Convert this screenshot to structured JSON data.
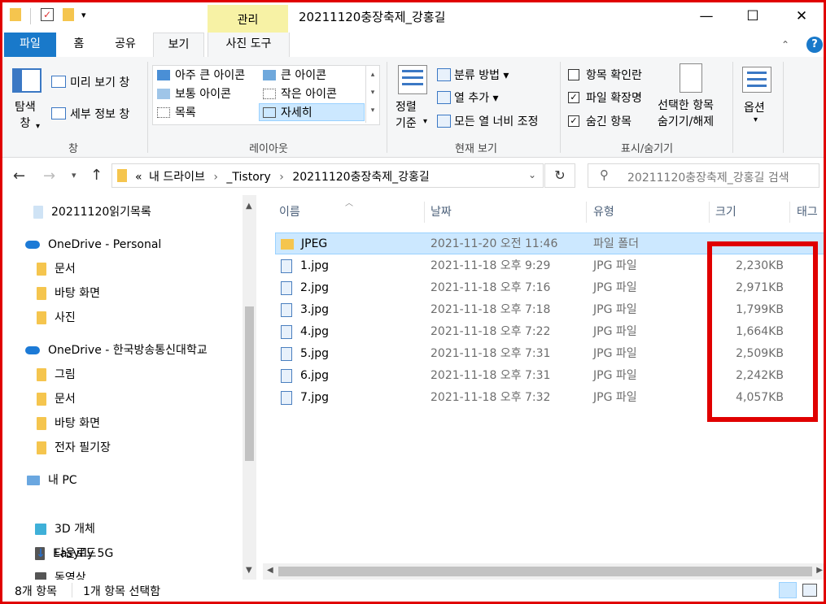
{
  "window": {
    "title": "20211120충장축제_강홍길",
    "context_tab": "관리",
    "controls": {
      "minimize": "—",
      "maximize": "☐",
      "close": "✕"
    }
  },
  "ribbon_tabs": [
    {
      "label": "파일"
    },
    {
      "label": "홈"
    },
    {
      "label": "공유"
    },
    {
      "label": "보기"
    },
    {
      "label": "사진 도구"
    }
  ],
  "ribbon": {
    "pane": {
      "nav_pane": "탐색\n창",
      "preview": "미리 보기 창",
      "details": "세부 정보 창",
      "group": "창"
    },
    "layout": {
      "items": [
        "아주 큰 아이콘",
        "큰 아이콘",
        "보통 아이콘",
        "작은 아이콘",
        "목록",
        "자세히"
      ],
      "group": "레이아웃"
    },
    "current_view": {
      "sort_by": "정렬\n기준",
      "group_by": "분류 방법",
      "add_columns": "열 추가",
      "fit_columns": "모든 열 너비 조정",
      "group": "현재 보기"
    },
    "show_hide": {
      "checkboxes": "항목 확인란",
      "extensions": "파일 확장명",
      "hidden": "숨긴 항목",
      "hide_selected": "선택한 항목\n숨기기/해제",
      "group": "표시/숨기기"
    },
    "options": {
      "label": "옵션"
    }
  },
  "address": {
    "crumbs": [
      "«",
      "내 드라이브",
      "_Tistory",
      "20211120충장축제_강홍길"
    ],
    "search_placeholder": "20211120충장축제_강홍길 검색"
  },
  "nav": {
    "items": [
      {
        "label": "20211120읽기목록",
        "icon": "cloud-folder"
      },
      {
        "label": "OneDrive - Personal",
        "icon": "onedrive"
      },
      {
        "label": "문서",
        "icon": "folder"
      },
      {
        "label": "바탕 화면",
        "icon": "folder"
      },
      {
        "label": "사진",
        "icon": "folder"
      },
      {
        "label": "OneDrive - 한국방송통신대학교",
        "icon": "onedrive"
      },
      {
        "label": "그림",
        "icon": "folder"
      },
      {
        "label": "문서",
        "icon": "folder"
      },
      {
        "label": "바탕 화면",
        "icon": "folder"
      },
      {
        "label": "전자 필기장",
        "icon": "folder"
      },
      {
        "label": "내 PC",
        "icon": "pc"
      },
      {
        "label": "3D 개체",
        "icon": "3d"
      },
      {
        "label": "Easyfly 5G",
        "icon": "device"
      },
      {
        "label": "다운로드",
        "icon": "download"
      },
      {
        "label": "동영상",
        "icon": "video"
      }
    ]
  },
  "columns": {
    "name": "이름",
    "date": "날짜",
    "type": "유형",
    "size": "크기",
    "tags": "태그"
  },
  "files": [
    {
      "name": "JPEG",
      "date": "2021-11-20 오전 11:46",
      "type": "파일 폴더",
      "size": ""
    },
    {
      "name": "1.jpg",
      "date": "2021-11-18 오후 9:29",
      "type": "JPG 파일",
      "size": "2,230KB"
    },
    {
      "name": "2.jpg",
      "date": "2021-11-18 오후 7:16",
      "type": "JPG 파일",
      "size": "2,971KB"
    },
    {
      "name": "3.jpg",
      "date": "2021-11-18 오후 7:18",
      "type": "JPG 파일",
      "size": "1,799KB"
    },
    {
      "name": "4.jpg",
      "date": "2021-11-18 오후 7:22",
      "type": "JPG 파일",
      "size": "1,664KB"
    },
    {
      "name": "5.jpg",
      "date": "2021-11-18 오후 7:31",
      "type": "JPG 파일",
      "size": "2,509KB"
    },
    {
      "name": "6.jpg",
      "date": "2021-11-18 오후 7:31",
      "type": "JPG 파일",
      "size": "2,242KB"
    },
    {
      "name": "7.jpg",
      "date": "2021-11-18 오후 7:32",
      "type": "JPG 파일",
      "size": "4,057KB"
    }
  ],
  "status": {
    "count": "8개 항목",
    "selected": "1개 항목 선택함"
  },
  "colors": {
    "accent": "#1979ca",
    "highlight": "#e00000",
    "selection": "#cce8ff"
  }
}
